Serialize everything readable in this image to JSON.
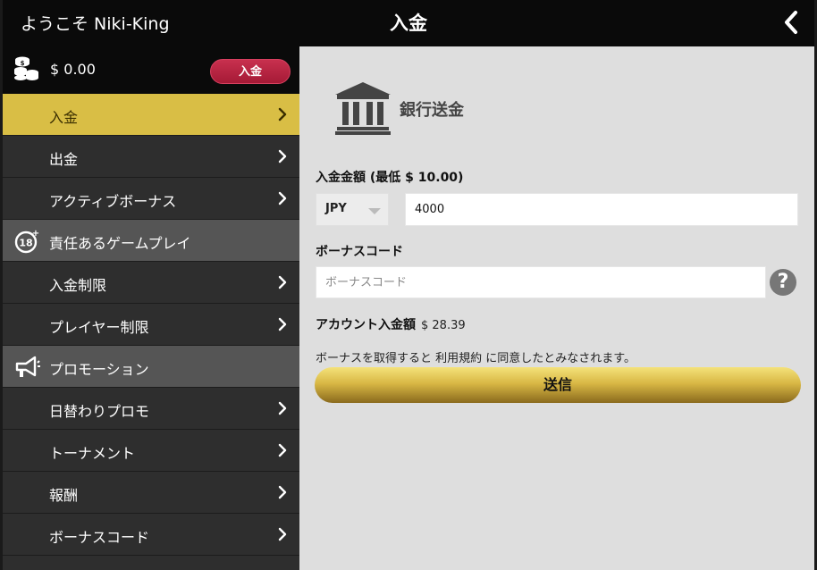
{
  "header": {
    "welcome": "ようこそ Niki-King",
    "title": "入金",
    "back_icon": "chevron-left-icon"
  },
  "balance": {
    "amount": "$ 0.00",
    "deposit_button": "入金"
  },
  "menu": [
    {
      "label": "入金",
      "type": "item",
      "active": true
    },
    {
      "label": "出金",
      "type": "item"
    },
    {
      "label": "アクティブボーナス",
      "type": "item"
    },
    {
      "label": "責任あるゲームプレイ",
      "type": "section",
      "icon": "age-18-icon"
    },
    {
      "label": "入金制限",
      "type": "item"
    },
    {
      "label": "プレイヤー制限",
      "type": "item"
    },
    {
      "label": "プロモーション",
      "type": "section",
      "icon": "megaphone-icon"
    },
    {
      "label": "日替わりプロモ",
      "type": "item"
    },
    {
      "label": "トーナメント",
      "type": "item"
    },
    {
      "label": "報酬",
      "type": "item"
    },
    {
      "label": "ボーナスコード",
      "type": "item"
    }
  ],
  "content": {
    "method_title": "銀行送金",
    "amount_label": "入金金額",
    "min_label": "(最低 $ 10.00)",
    "currency": "JPY",
    "amount_value": "4000",
    "bonus_label": "ボーナスコード",
    "bonus_placeholder": "ボーナスコード",
    "account_label": "アカウント入金額",
    "account_value": "$ 28.39",
    "terms": "ボーナスを取得すると 利用規約 に同意したとみなされます。",
    "submit": "送信"
  },
  "colors": {
    "active_item": "#d9be45",
    "section_bg": "#555555",
    "deposit_button": "#b82240"
  }
}
